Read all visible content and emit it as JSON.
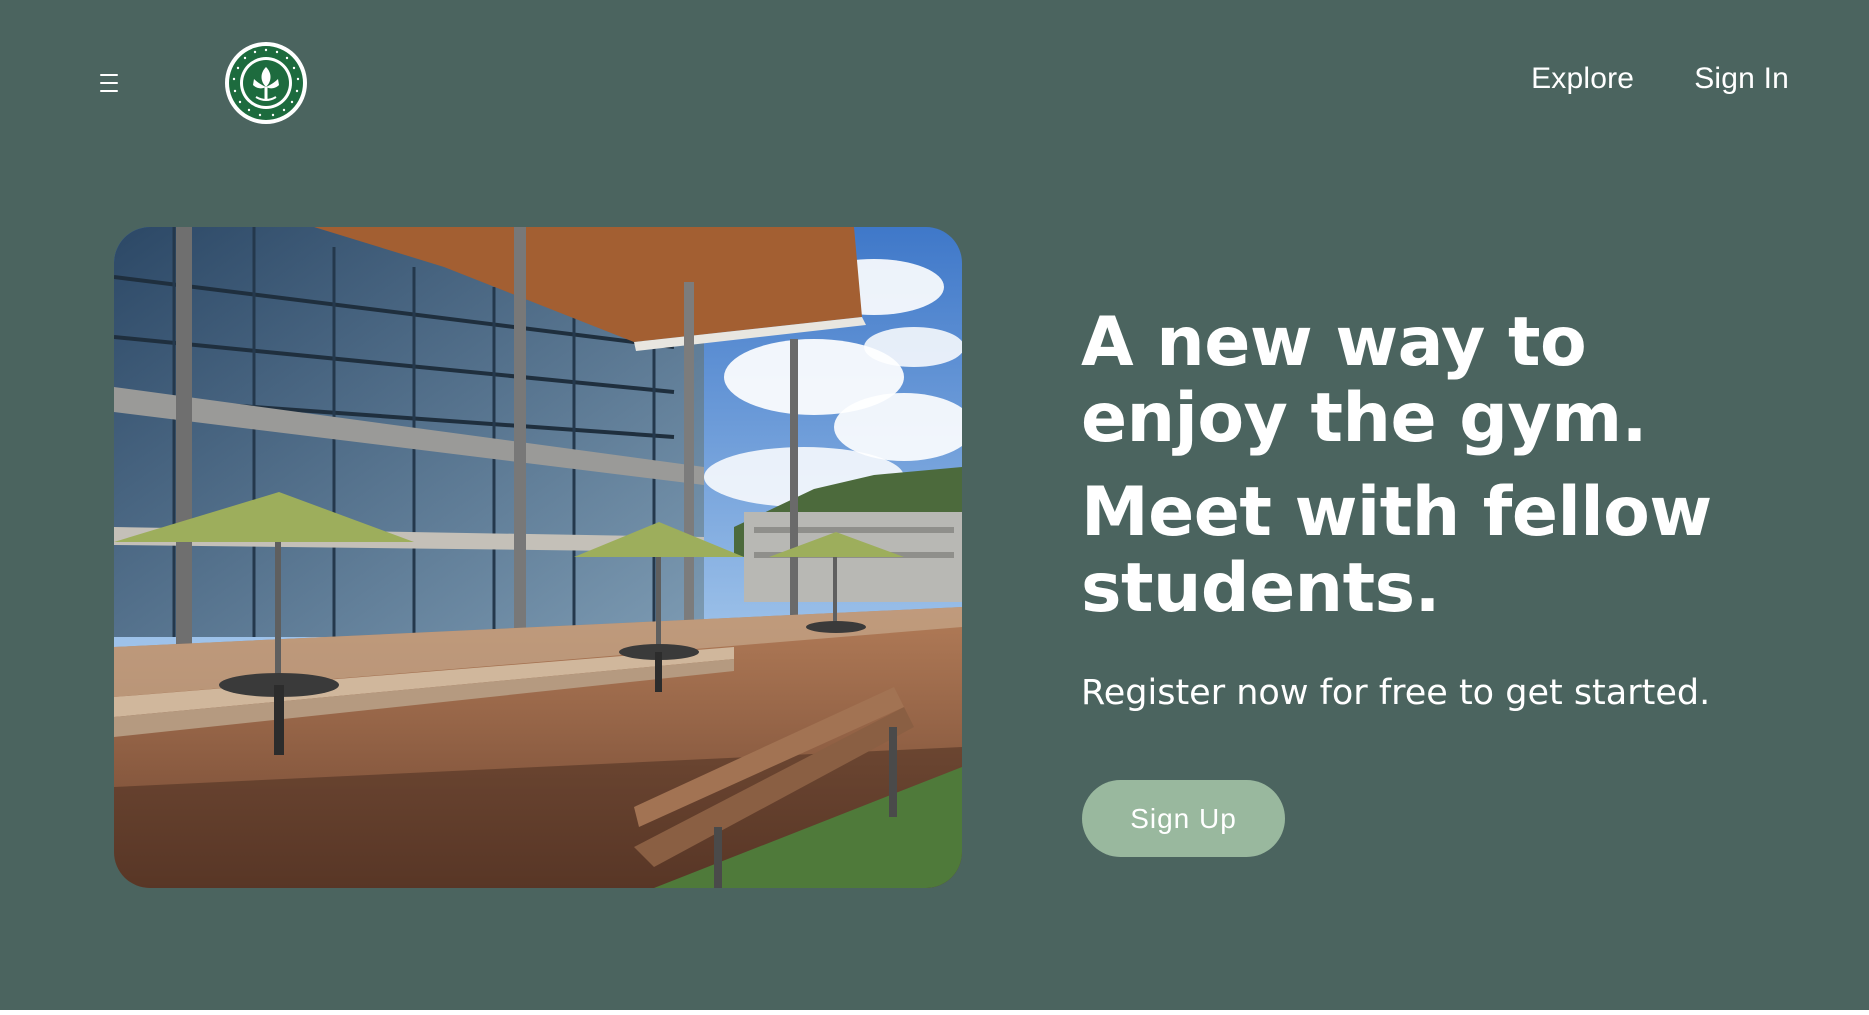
{
  "header": {
    "menu_icon": "hamburger-menu-icon",
    "logo_icon": "university-seal-logo",
    "nav": {
      "explore": "Explore",
      "sign_in": "Sign In"
    }
  },
  "hero": {
    "image_icon": "campus-building-courtyard-photo",
    "headline_1": "A new way to enjoy the gym.",
    "headline_2": "Meet with fellow students.",
    "subtitle": "Register now for free to get started.",
    "signup_label": "Sign Up"
  },
  "colors": {
    "background": "#4b645f",
    "button": "#99b89e",
    "text": "#ffffff",
    "logo_green": "#1d6b3e"
  }
}
